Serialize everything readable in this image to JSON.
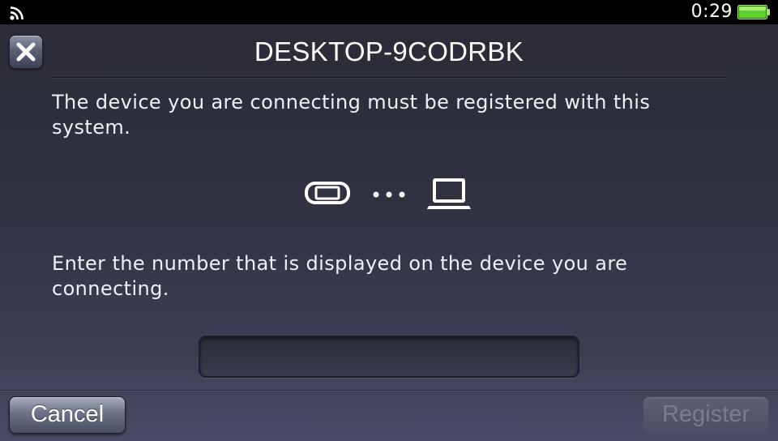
{
  "status_bar": {
    "time": "0:29",
    "wifi_icon": "wifi-icon",
    "battery_icon": "battery-icon",
    "battery_color": "#5fd12c"
  },
  "header": {
    "title": "DESKTOP-9CODRBK",
    "close_icon": "close-icon"
  },
  "main": {
    "message_register": "The device you are connecting must be registered with this system.",
    "illustration": {
      "left_icon": "ps-vita-icon",
      "middle_icon": "ellipsis-icon",
      "right_icon": "laptop-icon"
    },
    "message_enter_number": "Enter the number that is displayed on the device you are connecting.",
    "code_input": {
      "value": "",
      "placeholder": ""
    }
  },
  "footer": {
    "cancel_label": "Cancel",
    "register_label": "Register",
    "register_enabled": false
  }
}
